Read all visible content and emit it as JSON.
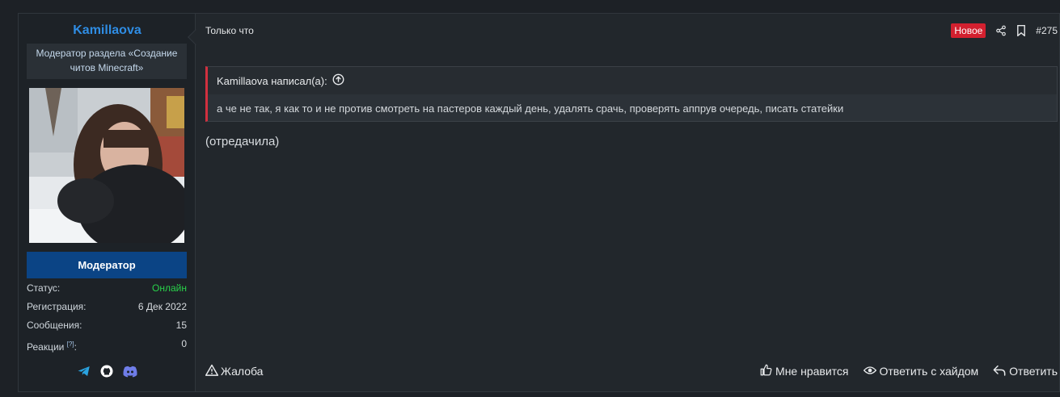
{
  "user": {
    "name": "Kamillaova",
    "title": "Модератор раздела «Создание читов Minecraft»",
    "role_banner": "Модератор",
    "stats": [
      {
        "label": "Статус:",
        "value": "Онлайн"
      },
      {
        "label": "Регистрация:",
        "value": "6 Дек 2022"
      },
      {
        "label": "Сообщения:",
        "value": "15"
      },
      {
        "label": "Реакции",
        "sup": "[?]",
        "suffix": ":",
        "value": "0"
      }
    ],
    "socials": [
      "telegram-icon",
      "github-icon",
      "discord-icon"
    ]
  },
  "post": {
    "time": "Только что",
    "badge": "Новое",
    "number": "#275",
    "quote": {
      "author": "Kamillaova написал(а):",
      "text": "а че не так, я как то и не против смотреть на пастеров каждый день, удалять срачь, проверять аппрув очередь, писать статейки"
    },
    "message": "(отредачила)"
  },
  "actions": {
    "report": "Жалоба",
    "like": "Мне нравится",
    "reply_hide": "Ответить с хайдом",
    "reply": "Ответить"
  },
  "colors": {
    "username": "#2f8de4",
    "role_banner": "#0b4485",
    "online": "#29d24a",
    "badge_new": "#d3202f",
    "quote_border": "#d1303f"
  }
}
